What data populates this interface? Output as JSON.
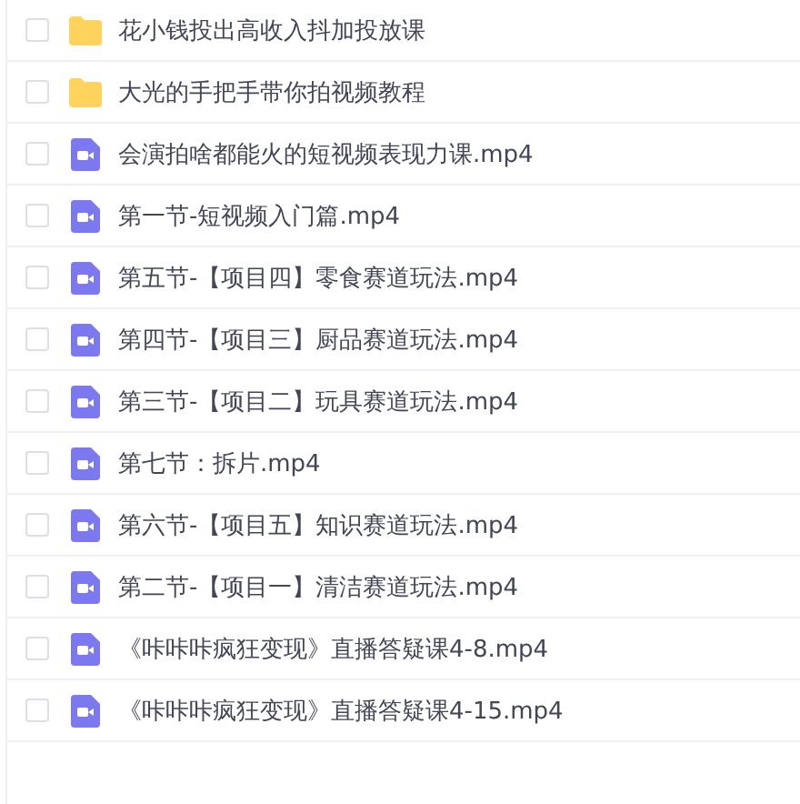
{
  "files": [
    {
      "kind": "folder",
      "name": "花小钱投出高收入抖加投放课",
      "checked": false
    },
    {
      "kind": "folder",
      "name": "大光的手把手带你拍视频教程",
      "checked": false
    },
    {
      "kind": "video",
      "name": "会演拍啥都能火的短视频表现力课.mp4",
      "checked": false
    },
    {
      "kind": "video",
      "name": "第一节-短视频入门篇.mp4",
      "checked": false
    },
    {
      "kind": "video",
      "name": "第五节-【项目四】零食赛道玩法.mp4",
      "checked": false
    },
    {
      "kind": "video",
      "name": "第四节-【项目三】厨品赛道玩法.mp4",
      "checked": false
    },
    {
      "kind": "video",
      "name": "第三节-【项目二】玩具赛道玩法.mp4",
      "checked": false
    },
    {
      "kind": "video",
      "name": "第七节：拆片.mp4",
      "checked": false
    },
    {
      "kind": "video",
      "name": "第六节-【项目五】知识赛道玩法.mp4",
      "checked": false
    },
    {
      "kind": "video",
      "name": "第二节-【项目一】清洁赛道玩法.mp4",
      "checked": false
    },
    {
      "kind": "video",
      "name": "《咔咔咔疯狂变现》直播答疑课4-8.mp4",
      "checked": false
    },
    {
      "kind": "video",
      "name": "《咔咔咔疯狂变现》直播答疑课4-15.mp4",
      "checked": false
    }
  ]
}
